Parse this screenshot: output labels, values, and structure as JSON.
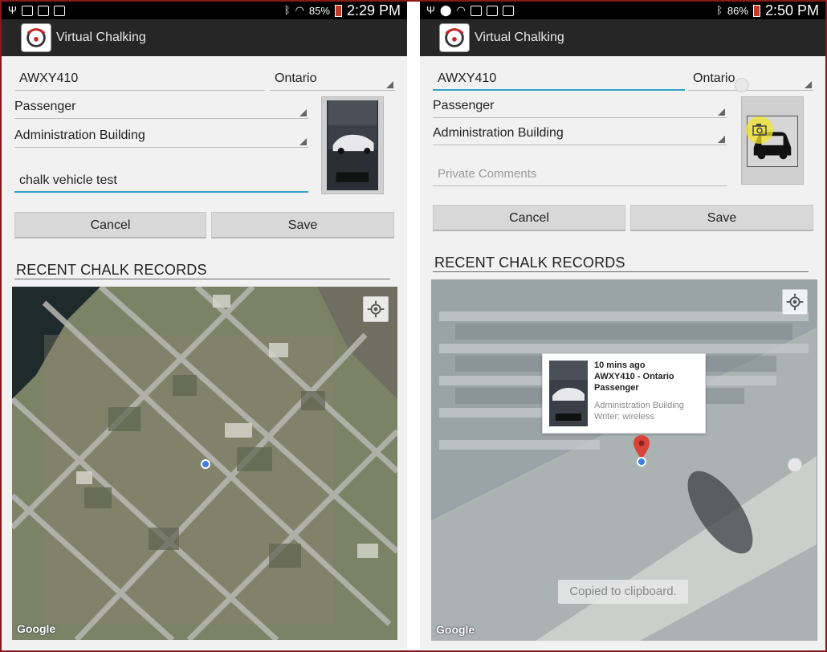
{
  "left": {
    "status": {
      "battery": "85%",
      "time": "2:29 PM"
    },
    "app_title": "Virtual Chalking",
    "plate_value": "AWXY410",
    "province_value": "Ontario",
    "type_value": "Passenger",
    "location_value": "Administration Building",
    "comments_value": "chalk vehicle test",
    "cancel_label": "Cancel",
    "save_label": "Save",
    "section_title": "RECENT CHALK RECORDS",
    "map_attribution": "Google"
  },
  "right": {
    "status": {
      "battery": "86%",
      "time": "2:50 PM"
    },
    "app_title": "Virtual Chalking",
    "plate_value": "AWXY410",
    "province_value": "Ontario",
    "type_value": "Passenger",
    "location_value": "Administration Building",
    "comments_placeholder": "Private Comments",
    "cancel_label": "Cancel",
    "save_label": "Save",
    "section_title": "RECENT CHALK RECORDS",
    "info_window": {
      "time_ago": "10 mins ago",
      "plate_province": "AWXY410 - Ontario",
      "vehicle_type": "Passenger",
      "location": "Administration Building",
      "writer": "Writer: wireless"
    },
    "toast": "Copied to clipboard.",
    "map_attribution": "Google"
  },
  "icons": [
    "usb-icon",
    "image-icon",
    "gmail-icon",
    "briefcase-icon",
    "bluetooth-icon",
    "wifi-icon",
    "battery-icon",
    "location-icon",
    "my-location-icon",
    "camera-icon",
    "car-icon",
    "map-marker-icon",
    "spinner-arrow-icon"
  ],
  "colors": {
    "accent": "#33a3c8",
    "action_bar": "#262626",
    "status_bar": "#000000",
    "marker": "#d9433a",
    "my_location": "#3a7fe0"
  }
}
